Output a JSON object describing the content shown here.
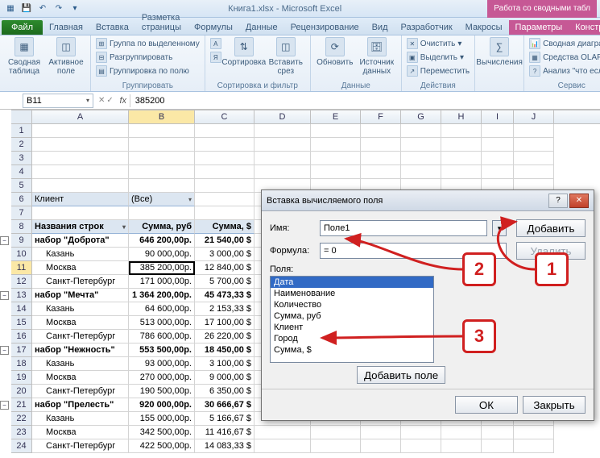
{
  "app": {
    "title": "Книга1.xlsx - Microsoft Excel",
    "context_tab_group": "Работа со сводными табл"
  },
  "qat": {
    "save": "save",
    "undo": "undo",
    "redo": "redo"
  },
  "tabs": {
    "file": "Файл",
    "items": [
      "Главная",
      "Вставка",
      "Разметка страницы",
      "Формулы",
      "Данные",
      "Рецензирование",
      "Вид",
      "Разработчик",
      "Макросы"
    ],
    "context": [
      "Параметры",
      "Констру"
    ]
  },
  "ribbon": {
    "g1": {
      "btn1": "Сводная\nтаблица",
      "btn2": "Активное\nполе",
      "label": ""
    },
    "g2": {
      "r1": "Группа по выделенному",
      "r2": "Разгруппировать",
      "r3": "Группировка по полю",
      "label": "Группировать"
    },
    "g3": {
      "sort_az": "А↓Я",
      "sort_za": "Я↓А",
      "sort": "Сортировка",
      "slicer": "Вставить\nсрез",
      "label": "Сортировка и фильтр"
    },
    "g4": {
      "refresh": "Обновить",
      "source": "Источник\nданных",
      "label": "Данные"
    },
    "g5": {
      "clear": "Очистить",
      "select": "Выделить",
      "move": "Переместить",
      "label": "Действия"
    },
    "g6": {
      "calc": "Вычисления",
      "label": ""
    },
    "g7": {
      "chart": "Сводная диаграмм",
      "olap": "Средства OLAP",
      "whatif": "Анализ \"что если\"",
      "label": "Сервис"
    }
  },
  "namebox": "B11",
  "formula": "385200",
  "columns": [
    "A",
    "B",
    "C",
    "D",
    "E",
    "F",
    "G",
    "H",
    "I",
    "J"
  ],
  "row_labels_header": "Названия строк",
  "col_b_header": "Сумма, руб",
  "col_c_header": "Сумма, $",
  "client_label": "Клиент",
  "client_value": "(Все)",
  "table": [
    {
      "n": 9,
      "collapse": true,
      "a": "набор \"Доброта\"",
      "b": "646 200,00р.",
      "c": "21 540,00 $",
      "bold": true,
      "indent": 0
    },
    {
      "n": 10,
      "a": "Казань",
      "b": "90 000,00р.",
      "c": "3 000,00 $",
      "indent": 1
    },
    {
      "n": 11,
      "a": "Москва",
      "b": "385 200,00р.",
      "c": "12 840,00 $",
      "indent": 1,
      "sel": true
    },
    {
      "n": 12,
      "a": "Санкт-Петербург",
      "b": "171 000,00р.",
      "c": "5 700,00 $",
      "indent": 1
    },
    {
      "n": 13,
      "collapse": true,
      "a": "набор \"Мечта\"",
      "b": "1 364 200,00р.",
      "c": "45 473,33 $",
      "bold": true,
      "indent": 0
    },
    {
      "n": 14,
      "a": "Казань",
      "b": "64 600,00р.",
      "c": "2 153,33 $",
      "indent": 1
    },
    {
      "n": 15,
      "a": "Москва",
      "b": "513 000,00р.",
      "c": "17 100,00 $",
      "indent": 1
    },
    {
      "n": 16,
      "a": "Санкт-Петербург",
      "b": "786 600,00р.",
      "c": "26 220,00 $",
      "indent": 1
    },
    {
      "n": 17,
      "collapse": true,
      "a": "набор \"Нежность\"",
      "b": "553 500,00р.",
      "c": "18 450,00 $",
      "bold": true,
      "indent": 0
    },
    {
      "n": 18,
      "a": "Казань",
      "b": "93 000,00р.",
      "c": "3 100,00 $",
      "indent": 1
    },
    {
      "n": 19,
      "a": "Москва",
      "b": "270 000,00р.",
      "c": "9 000,00 $",
      "indent": 1
    },
    {
      "n": 20,
      "a": "Санкт-Петербург",
      "b": "190 500,00р.",
      "c": "6 350,00 $",
      "indent": 1
    },
    {
      "n": 21,
      "collapse": true,
      "a": "набор \"Прелесть\"",
      "b": "920 000,00р.",
      "c": "30 666,67 $",
      "bold": true,
      "indent": 0
    },
    {
      "n": 22,
      "a": "Казань",
      "b": "155 000,00р.",
      "c": "5 166,67 $",
      "indent": 1
    },
    {
      "n": 23,
      "a": "Москва",
      "b": "342 500,00р.",
      "c": "11 416,67 $",
      "indent": 1
    },
    {
      "n": 24,
      "a": "Санкт-Петербург",
      "b": "422 500,00р.",
      "c": "14 083,33 $",
      "indent": 1
    }
  ],
  "dialog": {
    "title": "Вставка вычисляемого поля",
    "name_label": "Имя:",
    "name_value": "Поле1",
    "formula_label": "Формула:",
    "formula_value": "= 0",
    "add": "Добавить",
    "delete": "Удалить",
    "fields_label": "Поля:",
    "fields": [
      "Дата",
      "Наименование",
      "Количество",
      "Сумма, руб",
      "Клиент",
      "Город",
      "Сумма, $"
    ],
    "add_field": "Добавить поле",
    "ok": "ОК",
    "close": "Закрыть"
  },
  "callouts": {
    "c1": "1",
    "c2": "2",
    "c3": "3"
  }
}
